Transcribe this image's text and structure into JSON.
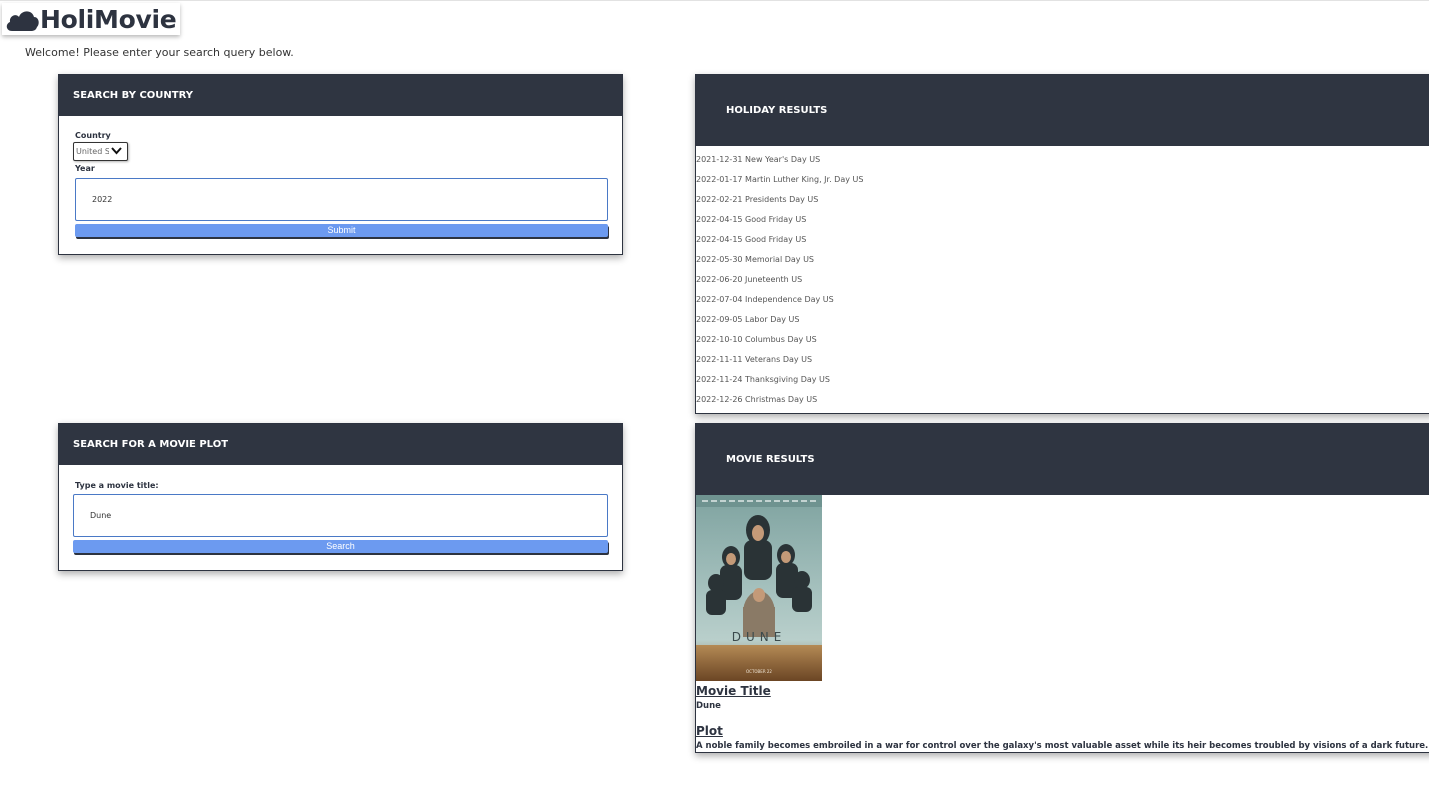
{
  "app": {
    "name": "HoliMovie",
    "welcome": "Welcome! Please enter your search query below."
  },
  "country_search": {
    "title": "SEARCH BY COUNTRY",
    "country_label": "Country",
    "country_value": "United S",
    "year_label": "Year",
    "year_value": "2022",
    "submit_label": "Submit"
  },
  "holiday_results": {
    "title": "HOLIDAY RESULTS",
    "items": [
      "2021-12-31 New Year's Day US",
      "2022-01-17 Martin Luther King, Jr. Day US",
      "2022-02-21 Presidents Day US",
      "2022-04-15 Good Friday US",
      "2022-04-15 Good Friday US",
      "2022-05-30 Memorial Day US",
      "2022-06-20 Juneteenth US",
      "2022-07-04 Independence Day US",
      "2022-09-05 Labor Day US",
      "2022-10-10 Columbus Day US",
      "2022-11-11 Veterans Day US",
      "2022-11-24 Thanksgiving Day US",
      "2022-12-26 Christmas Day US"
    ]
  },
  "movie_search": {
    "title": "SEARCH FOR A MOVIE PLOT",
    "field_label": "Type a movie title:",
    "field_value": "Dune",
    "search_label": "Search"
  },
  "movie_results": {
    "title": "MOVIE RESULTS",
    "poster_text": "DUNE",
    "poster_date": "OCTOBER 22",
    "movie_title_heading": "Movie Title",
    "movie_title": "Dune",
    "plot_heading": "Plot",
    "plot": "A noble family becomes embroiled in a war for control over the galaxy's most valuable asset while its heir becomes troubled by visions of a dark future."
  },
  "colors": {
    "header_bg": "#2f3541",
    "button": "#6c9af0",
    "input_border": "#4a79c6"
  },
  "icons": {
    "logo": "cloud-icon",
    "select": "chevron-down-icon"
  }
}
